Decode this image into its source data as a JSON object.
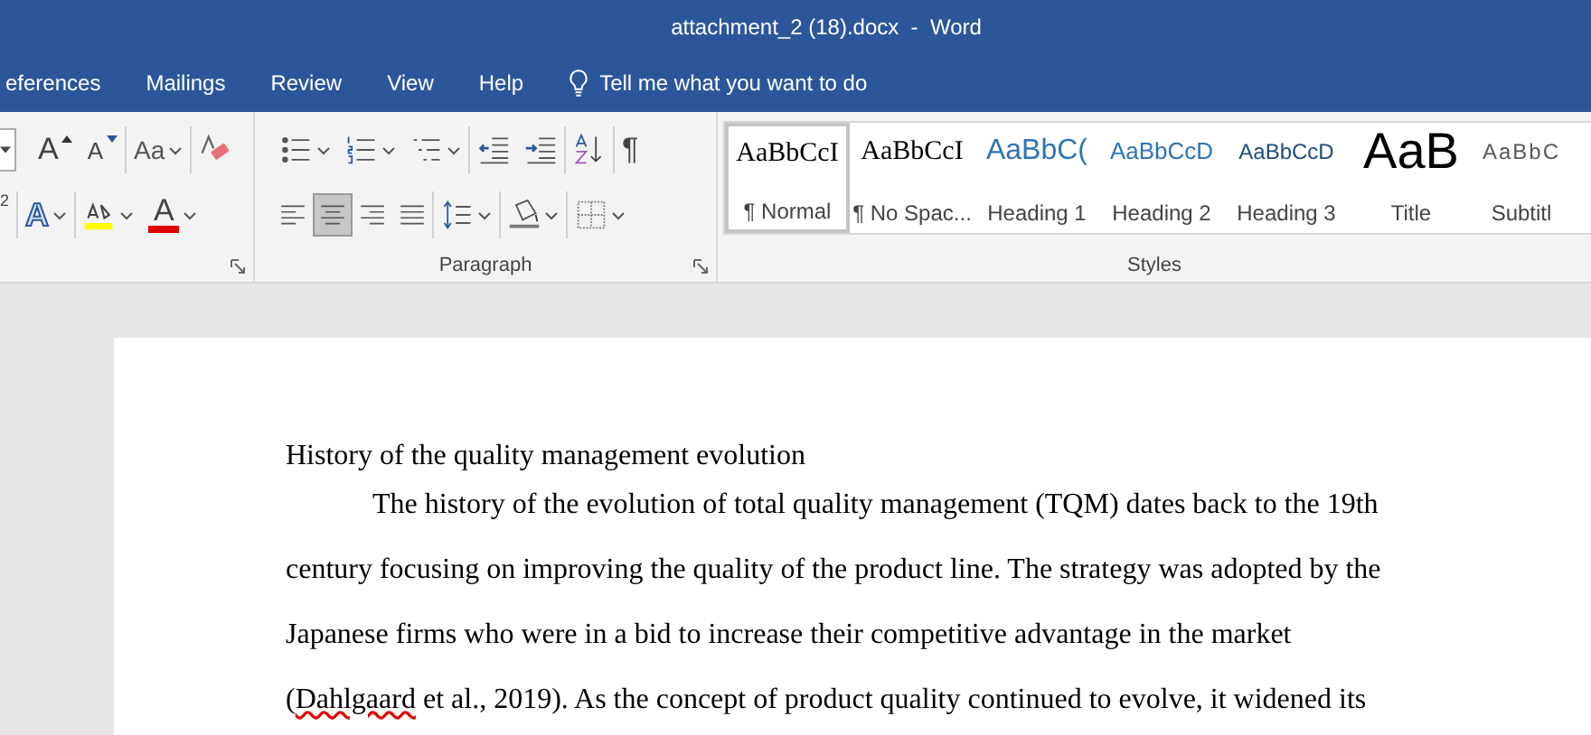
{
  "window": {
    "title": "attachment_2 (18).docx  -  Word"
  },
  "tabs": [
    {
      "label": "eferences"
    },
    {
      "label": "Mailings"
    },
    {
      "label": "Review"
    },
    {
      "label": "View"
    },
    {
      "label": "Help"
    }
  ],
  "tell_me": {
    "placeholder": "Tell me what you want to do"
  },
  "font_group": {
    "row1": [
      {
        "kind": "size_field"
      },
      {
        "kind": "grow",
        "label": "A"
      },
      {
        "kind": "shrink",
        "label": "A"
      },
      {
        "kind": "case",
        "label": "Aa",
        "dropdown": true
      },
      {
        "kind": "clear"
      }
    ],
    "row2": [
      {
        "kind": "superscript",
        "label": "2"
      },
      {
        "kind": "effects",
        "label": "A",
        "dropdown": true
      },
      {
        "kind": "highlight",
        "dropdown": true
      },
      {
        "kind": "font_color",
        "label": "A",
        "dropdown": true
      }
    ]
  },
  "paragraph_group": {
    "label": "Paragraph",
    "row1": [
      {
        "kind": "bullets",
        "dropdown": true
      },
      {
        "kind": "numbering",
        "dropdown": true
      },
      {
        "kind": "multilevel",
        "dropdown": true
      },
      {
        "kind": "outdent"
      },
      {
        "kind": "indent"
      },
      {
        "kind": "sort"
      },
      {
        "kind": "marks",
        "label": "¶"
      }
    ],
    "alignment": [
      {
        "kind": "left",
        "selected": false
      },
      {
        "kind": "center",
        "selected": true
      },
      {
        "kind": "right",
        "selected": false
      },
      {
        "kind": "justify",
        "selected": false
      }
    ],
    "row2": [
      {
        "kind": "spacing",
        "dropdown": true
      },
      {
        "kind": "shading",
        "dropdown": true
      },
      {
        "kind": "borders",
        "dropdown": true
      }
    ]
  },
  "styles_group": {
    "label": "Styles",
    "styles": [
      {
        "kind": "normal",
        "preview": "AaBbCcI",
        "name": "¶ Normal",
        "selected": true
      },
      {
        "kind": "nospacing",
        "preview": "AaBbCcI",
        "name": "¶ No Spac...",
        "selected": false
      },
      {
        "kind": "heading1",
        "preview": "AaBbC(",
        "name": "Heading 1",
        "selected": false
      },
      {
        "kind": "heading2",
        "preview": "AaBbCcD",
        "name": "Heading 2",
        "selected": false
      },
      {
        "kind": "heading3",
        "preview": "AaBbCcD",
        "name": "Heading 3",
        "selected": false
      },
      {
        "kind": "title",
        "preview": "AaB",
        "name": "Title",
        "selected": false
      },
      {
        "kind": "subtitle",
        "preview": "AaBbC",
        "name": "Subtitl",
        "selected": false
      }
    ]
  },
  "document": {
    "heading": "History of the quality management evolution",
    "paragraph": [
      {
        "text": "The history of the evolution of total quality management (TQM) dates back to the 19th century focusing on improving the quality of the product line. The strategy was adopted by the Japanese firms who were in a bid to increase their competitive advantage in the market (",
        "spelling_error": false
      },
      {
        "text": "Dahlgaard",
        "spelling_error": true
      },
      {
        "text": " et al., 2019). As the concept of product quality continued to evolve, it widened its",
        "spelling_error": false
      }
    ]
  }
}
